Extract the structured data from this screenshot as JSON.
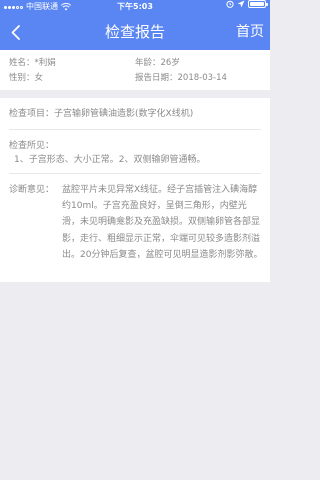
{
  "statusbar": {
    "carrier": "中国联通",
    "time": "下午5:03"
  },
  "nav": {
    "title": "检查报告",
    "home_label": "首页"
  },
  "patient": {
    "name_label": "姓名：",
    "name_value": "*利娟",
    "age_label": "年龄：",
    "age_value": "26岁",
    "gender_label": "性别：",
    "gender_value": "女",
    "date_label": "报告日期：",
    "date_value": "2018-03-14"
  },
  "report": {
    "exam_label": "检查项目：",
    "exam_value": "子宫输卵管碘油造影(数字化X线机)",
    "findings_label": "检查所见：",
    "findings_value": "1、子宫形态、大小正常。2、双侧输卵管通畅。",
    "diagnosis_label": "诊断意见：",
    "diagnosis_value": "盆腔平片未见异常X线征。经子宫插管注入碘海醇约10ml。子宫充盈良好，呈倒三角形，内壁光滑，未见明确龛影及充盈缺损。双侧输卵管各部显影，走行、粗细显示正常，伞端可见较多造影剂溢出。20分钟后复查，盆腔可见明显造影剂影弥散。"
  },
  "colors": {
    "header": "#5a86f3",
    "background": "#ececf1",
    "text_muted": "#8a8a8a"
  }
}
